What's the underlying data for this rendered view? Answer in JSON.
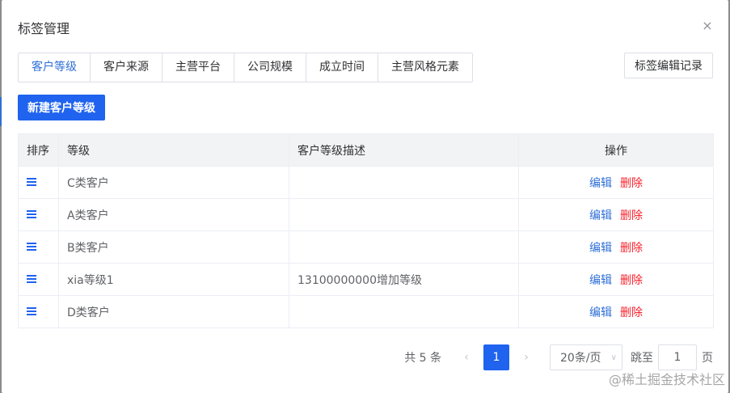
{
  "dialog": {
    "title": "标签管理",
    "close": "×"
  },
  "tabs": [
    {
      "label": "客户等级"
    },
    {
      "label": "客户来源"
    },
    {
      "label": "主营平台"
    },
    {
      "label": "公司规模"
    },
    {
      "label": "成立时间"
    },
    {
      "label": "主营风格元素"
    }
  ],
  "actions": {
    "history_label": "标签编辑记录",
    "new_label": "新建客户等级"
  },
  "table": {
    "headers": {
      "sort": "排序",
      "level": "等级",
      "desc": "客户等级描述",
      "op": "操作"
    },
    "rows": [
      {
        "level": "C类客户",
        "desc": "",
        "edit": "编辑",
        "delete": "删除"
      },
      {
        "level": "A类客户",
        "desc": "",
        "edit": "编辑",
        "delete": "删除"
      },
      {
        "level": "B类客户",
        "desc": "",
        "edit": "编辑",
        "delete": "删除"
      },
      {
        "level": "xia等级1",
        "desc": "13100000000增加等级",
        "edit": "编辑",
        "delete": "删除"
      },
      {
        "level": "D类客户",
        "desc": "",
        "edit": "编辑",
        "delete": "删除"
      }
    ]
  },
  "pagination": {
    "total": "共 5 条",
    "prev": "‹",
    "current": "1",
    "next": "›",
    "page_size": "20条/页",
    "jump_label": "跳至",
    "jump_value": "1",
    "page_suffix": "页"
  },
  "watermark": "@稀土掘金技术社区",
  "colors": {
    "primary": "#1f63ef",
    "danger": "#f5222d",
    "link": "#2f6fd6"
  }
}
